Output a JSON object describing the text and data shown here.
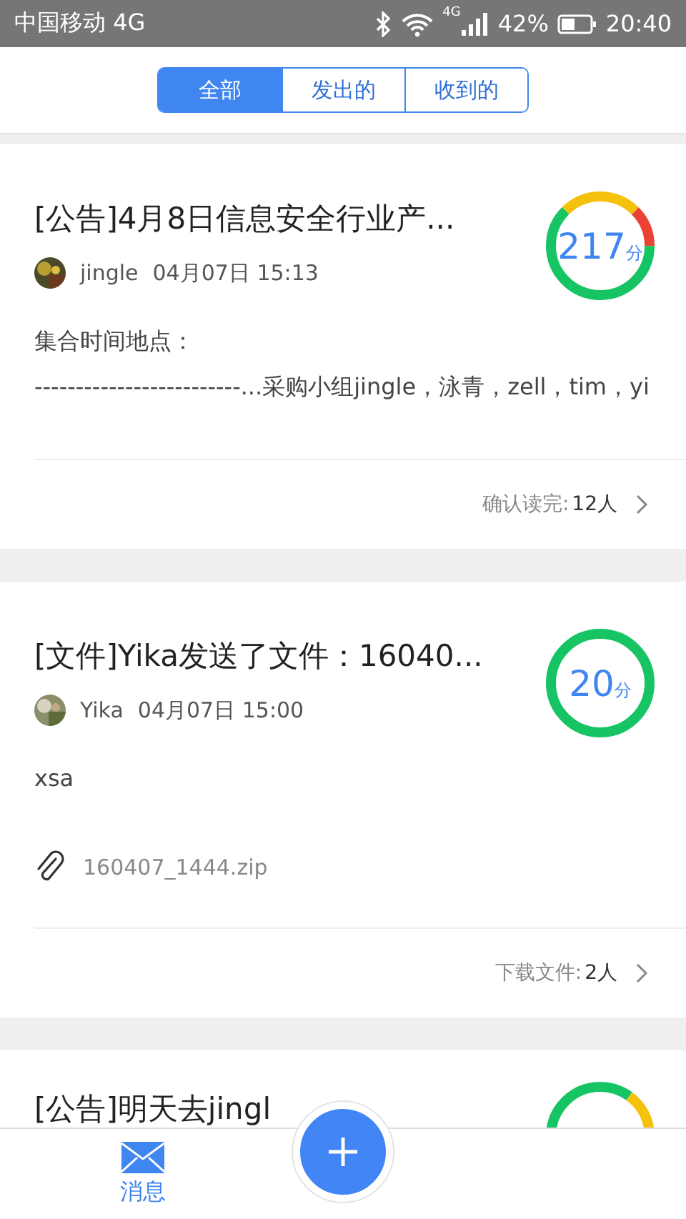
{
  "status_bar": {
    "carrier": "中国移动 4G",
    "network": "4G",
    "battery": "42%",
    "time": "20:40"
  },
  "tabs": [
    {
      "label": "全部",
      "selected": true
    },
    {
      "label": "发出的",
      "selected": false
    },
    {
      "label": "收到的",
      "selected": false
    }
  ],
  "cards": [
    {
      "title": "[公告]4月8日信息安全行业产...",
      "author": "jingle",
      "date": "04月07日 15:13",
      "score": "217",
      "score_unit": "分",
      "kind": "tricolor",
      "body": [
        "集合时间地点：",
        "-------------------------...采购小组jingle，泳青，zell，tim，yi"
      ],
      "footer_label": "确认读完:",
      "footer_count": "12人"
    },
    {
      "title": "[文件]Yika发送了文件：16040...",
      "author": "Yika",
      "date": "04月07日 15:00",
      "score": "20",
      "score_unit": "分",
      "kind": "green",
      "body": [
        "xsa"
      ],
      "attachment": "160407_1444.zip",
      "footer_label": "下载文件:",
      "footer_count": "2人"
    },
    {
      "title": "[公告]明天去jingl",
      "kind": "bicolor"
    }
  ],
  "nav": [
    {
      "label": "消息",
      "selected": true
    }
  ]
}
